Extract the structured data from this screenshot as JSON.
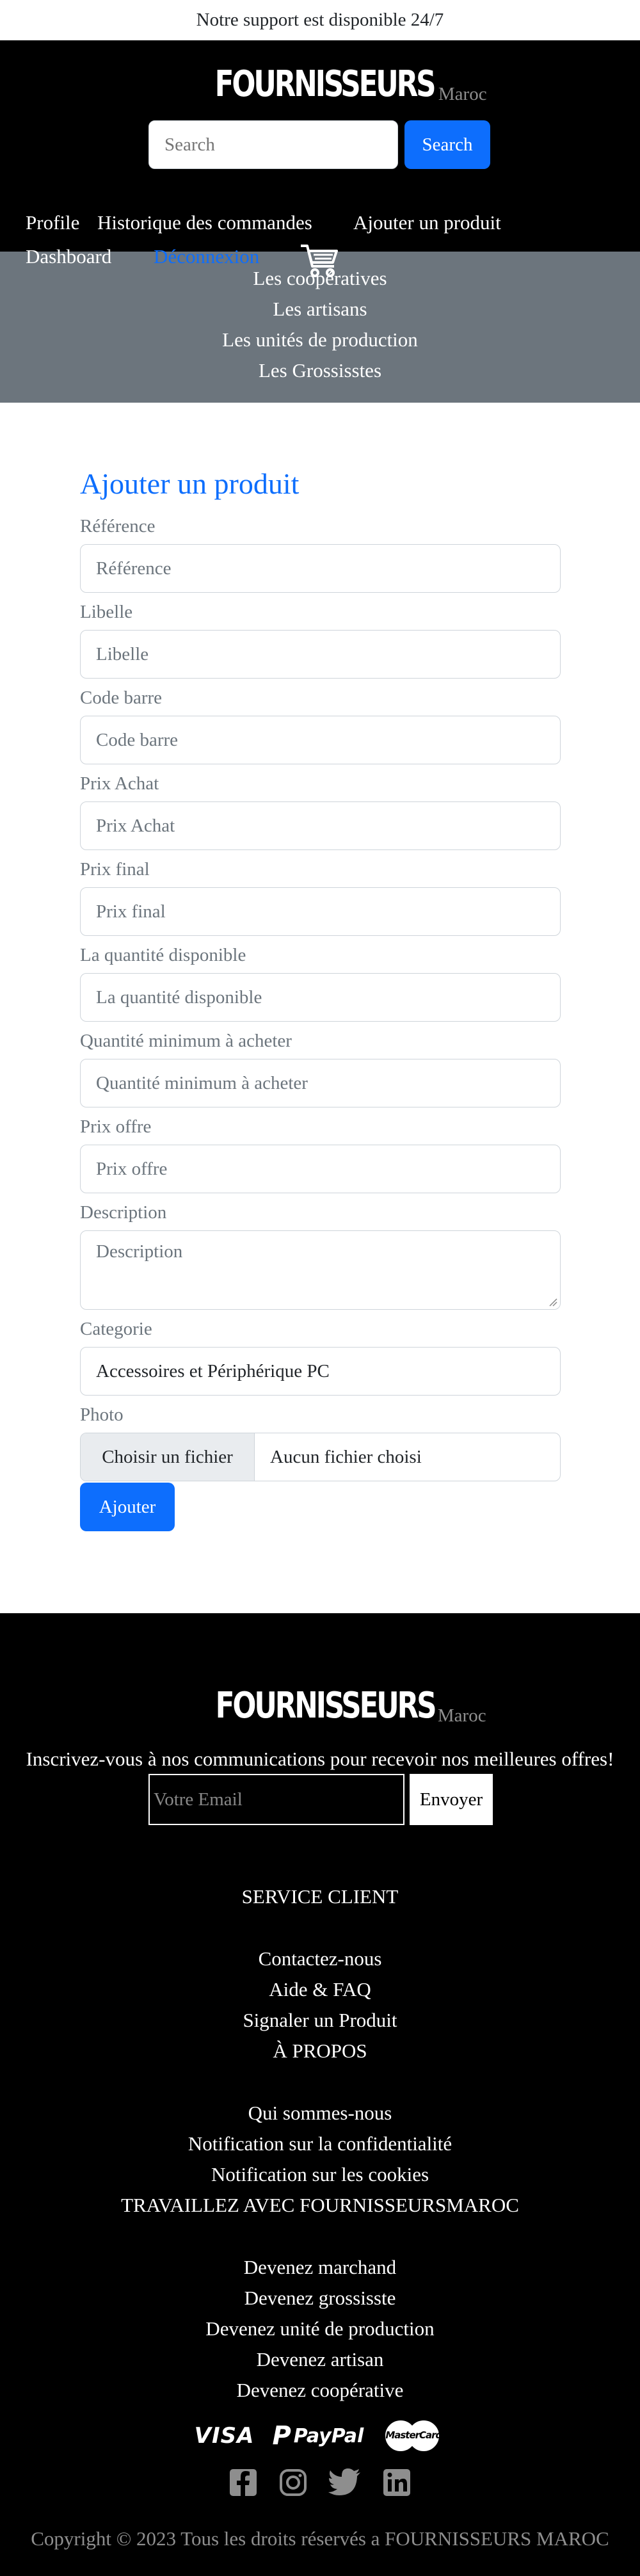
{
  "topbar": {
    "text": "Notre support est disponible 24/7"
  },
  "brand": {
    "name": "FOURNISSEURS",
    "sub": "Maroc"
  },
  "search": {
    "placeholder": "Search",
    "button": "Search"
  },
  "nav": {
    "profile": "Profile",
    "history": "Historique des commandes",
    "add_product": "Ajouter un produit",
    "dashboard": "Dashboard",
    "logout": "Déconnexion"
  },
  "categories": [
    "Les coopératives",
    "Les artisans",
    "Les unités de production",
    "Les Grossisstes"
  ],
  "form": {
    "title": "Ajouter un produit",
    "fields": [
      {
        "label": "Référence",
        "placeholder": "Référence"
      },
      {
        "label": "Libelle",
        "placeholder": "Libelle"
      },
      {
        "label": "Code barre",
        "placeholder": "Code barre"
      },
      {
        "label": "Prix Achat",
        "placeholder": "Prix Achat"
      },
      {
        "label": "Prix final",
        "placeholder": "Prix final"
      },
      {
        "label": "La quantité disponible",
        "placeholder": "La quantité disponible"
      },
      {
        "label": "Quantité minimum à acheter",
        "placeholder": "Quantité minimum à acheter"
      },
      {
        "label": "Prix offre",
        "placeholder": "Prix offre"
      }
    ],
    "description": {
      "label": "Description",
      "placeholder": "Description"
    },
    "category": {
      "label": "Categorie",
      "value": "Accessoires et Périphérique PC"
    },
    "photo": {
      "label": "Photo",
      "choose": "Choisir un fichier",
      "none": "Aucun fichier choisi"
    },
    "submit": "Ajouter"
  },
  "footer": {
    "newsletter_text": "Inscrivez-vous à nos communications pour recevoir nos meilleures offres!",
    "email_placeholder": "Votre Email",
    "send": "Envoyer",
    "service_title": "SERVICE CLIENT",
    "service_links": [
      "Contactez-nous",
      "Aide & FAQ",
      "Signaler un Produit",
      "À PROPOS"
    ],
    "about_links": [
      "Qui sommes-nous",
      "Notification sur la confidentialité",
      "Notification sur les cookies",
      "TRAVAILLEZ AVEC FOURNISSEURSMAROC"
    ],
    "become_links": [
      "Devenez marchand",
      "Devenez grossisste",
      "Devenez unité de production",
      "Devenez artisan",
      "Devenez coopérative"
    ],
    "payments": {
      "visa": "VISA",
      "paypal": "PayPal",
      "mastercard": "MasterCard"
    },
    "copyright": "Copyright © 2023 Tous les droits réservés a FOURNISSEURS MAROC"
  },
  "colors": {
    "primary": "#0d6efd",
    "header_bg": "#000000",
    "category_bg": "#6c757d",
    "muted": "#6c757d"
  }
}
